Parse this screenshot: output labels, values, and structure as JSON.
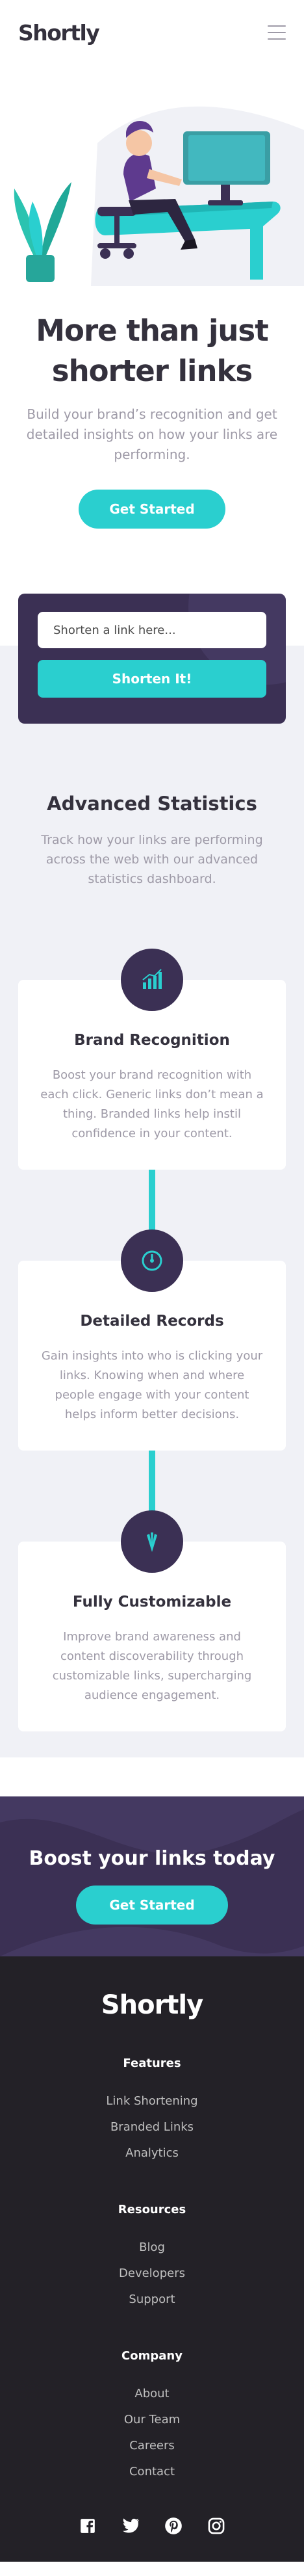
{
  "header": {
    "logo": "Shortly",
    "menu_icon": "hamburger-menu-icon"
  },
  "hero": {
    "title": "More than just shorter links",
    "subtitle": "Build your brand’s recognition and get detailed insights on how your links are performing.",
    "cta": "Get Started"
  },
  "shorten": {
    "placeholder": "Shorten a link here...",
    "button": "Shorten It!"
  },
  "stats": {
    "title": "Advanced Statistics",
    "subtitle": "Track how your links are performing across the web with our advanced statistics dashboard.",
    "cards": [
      {
        "icon": "bar-chart-icon",
        "title": "Brand Recognition",
        "text": "Boost your brand recognition with each click. Generic links don’t mean a thing. Branded links help instil confidence in your content."
      },
      {
        "icon": "gauge-icon",
        "title": "Detailed Records",
        "text": "Gain insights into who is clicking your links. Knowing when and where people engage with your content helps inform better decisions."
      },
      {
        "icon": "brush-tools-icon",
        "title": "Fully Customizable",
        "text": "Improve brand awareness and content discoverability through customizable links, supercharging audience engagement."
      }
    ]
  },
  "boost": {
    "title": "Boost your links today",
    "cta": "Get Started"
  },
  "footer": {
    "logo": "Shortly",
    "columns": [
      {
        "title": "Features",
        "links": [
          "Link Shortening",
          "Branded Links",
          "Analytics"
        ]
      },
      {
        "title": "Resources",
        "links": [
          "Blog",
          "Developers",
          "Support"
        ]
      },
      {
        "title": "Company",
        "links": [
          "About",
          "Our Team",
          "Careers",
          "Contact"
        ]
      }
    ],
    "social_icons": [
      "facebook-icon",
      "twitter-icon",
      "pinterest-icon",
      "instagram-icon"
    ]
  },
  "colors": {
    "primary": "#2acfcf",
    "dark_violet": "#3b3054",
    "grayish_violet": "#9e9aa7",
    "very_dark_violet": "#232127",
    "background_gray": "#f0f1f6"
  }
}
